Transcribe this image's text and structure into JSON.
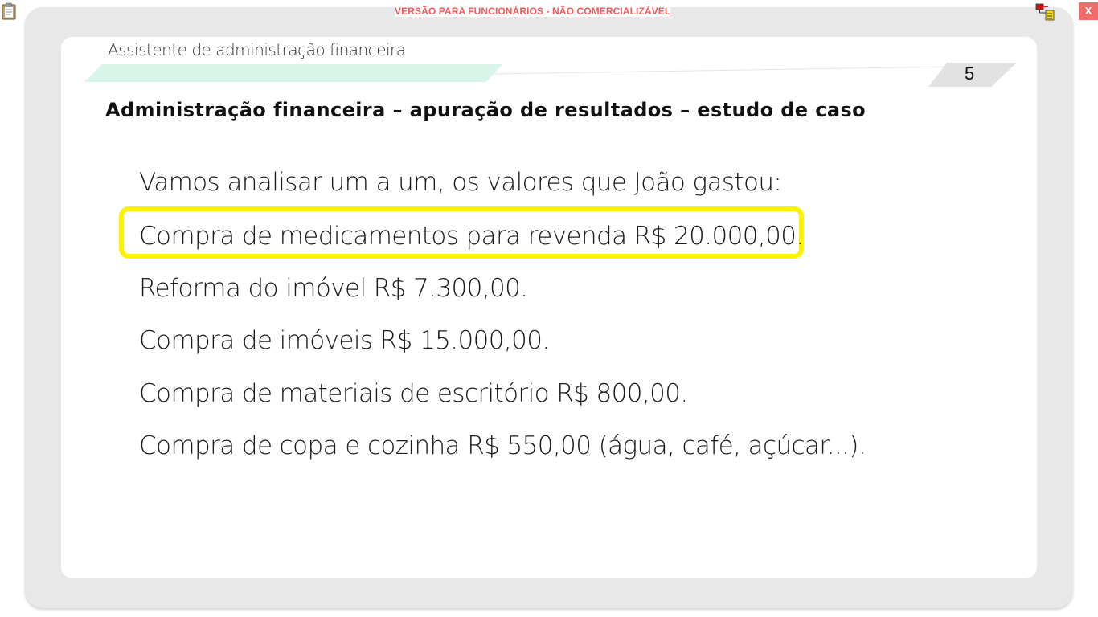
{
  "banner": {
    "text": "VERSÃO PARA FUNCIONÁRIOS - NÃO COMERCIALIZÁVEL"
  },
  "window": {
    "close_label": "X"
  },
  "icons": {
    "clipboard": "clipboard-icon",
    "navigation": "navigation-tree-icon"
  },
  "header": {
    "module_title": "Assistente de administração financeira",
    "page_number": "5"
  },
  "slide": {
    "heading": "Administração financeira – apuração de resultados – estudo de caso",
    "intro": "Vamos analisar um a um, os valores que João gastou:",
    "items": [
      {
        "text": "Compra de medicamentos para revenda R$ 20.000,00.",
        "highlighted": true
      },
      {
        "text": "Reforma do imóvel R$ 7.300,00.",
        "highlighted": false
      },
      {
        "text": "Compra de imóveis R$ 15.000,00.",
        "highlighted": false
      },
      {
        "text": "Compra de materiais de escritório R$ 800,00.",
        "highlighted": false
      },
      {
        "text": "Compra de copa e cozinha R$ 550,00 (água, café, açúcar...).",
        "highlighted": false
      }
    ]
  },
  "colors": {
    "banner_text": "#f05a5a",
    "close_button": "#f26b6b",
    "frame": "#e8e8e8",
    "header_accent": "#d8f5ea",
    "highlight": "#fff200"
  }
}
